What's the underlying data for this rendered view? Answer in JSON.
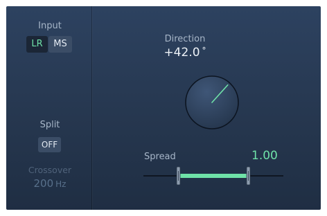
{
  "input": {
    "label": "Input",
    "options": [
      "LR",
      "MS"
    ],
    "selected": "LR"
  },
  "split": {
    "label": "Split",
    "value": "OFF"
  },
  "crossover": {
    "label": "Crossover",
    "value": "200",
    "unit": "Hz"
  },
  "direction": {
    "label": "Direction",
    "value": "+42.0",
    "unit": "°",
    "degrees": 42
  },
  "spread": {
    "label": "Spread",
    "value": "1.00",
    "range_start": 0.25,
    "range_end": 0.75
  },
  "colors": {
    "accent": "#6fe2a8",
    "label": "#a7b6c8",
    "disabled": "#58708b"
  }
}
